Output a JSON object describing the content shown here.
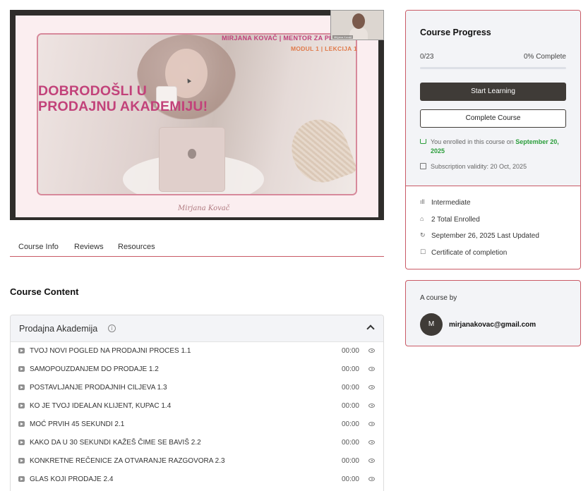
{
  "video": {
    "slide_line1": "MIRJANA KOVAČ  |  MENTOR ZA PRODAJU",
    "slide_line2": "MODUL 1  |  LEKCIJA 1",
    "slide_heading": "DOBRODOŠLI U PRODAJNU AKADEMIJU!",
    "slide_signature": "Mirjana Kovač",
    "pip_label": "Mirjana Kovač"
  },
  "tabs": [
    {
      "label": "Course Info"
    },
    {
      "label": "Reviews"
    },
    {
      "label": "Resources"
    }
  ],
  "course_content": {
    "title": "Course Content",
    "topic_title": "Prodajna Akademija",
    "lessons": [
      {
        "name": "TVOJ NOVI POGLED NA PRODAJNI PROCES 1.1",
        "duration": "00:00"
      },
      {
        "name": "SAMOPOUZDANJEM DO PRODAJE 1.2",
        "duration": "00:00"
      },
      {
        "name": "POSTAVLJANJE PRODAJNIH CILJEVA 1.3",
        "duration": "00:00"
      },
      {
        "name": "KO JE TVOJ IDEALAN KLIJENT, KUPAC 1.4",
        "duration": "00:00"
      },
      {
        "name": "MOĆ PRVIH 45 SEKUNDI 2.1",
        "duration": "00:00"
      },
      {
        "name": "KAKO DA U 30 SEKUNDI KAŽEŠ ČIME SE BAVIŠ 2.2",
        "duration": "00:00"
      },
      {
        "name": "KONKRETNE REČENICE ZA OTVARANJE RAZGOVORA 2.3",
        "duration": "00:00"
      },
      {
        "name": "GLAS KOJI PRODAJE 2.4",
        "duration": "00:00"
      }
    ]
  },
  "progress": {
    "title": "Course Progress",
    "count": "0/23",
    "percent": "0% Complete",
    "fraction": 0,
    "start_label": "Start Learning",
    "complete_label": "Complete Course",
    "enrolled_text": "You enrolled in this course on",
    "enrolled_date": "September 20, 2025",
    "validity": "Subscription validity: 20 Oct, 2025"
  },
  "meta": {
    "level": "Intermediate",
    "enrolled": "2 Total Enrolled",
    "updated": "September 26, 2025 Last Updated",
    "certificate": "Certificate of completion"
  },
  "author": {
    "label": "A course by",
    "initial": "M",
    "email": "mirjanakovac@gmail.com"
  },
  "colors": {
    "accent": "#c95a66",
    "dark_button": "#3f3b37",
    "success": "#2a9d3a",
    "slide_pink": "#c2427a",
    "slide_orange": "#e07a4a"
  }
}
